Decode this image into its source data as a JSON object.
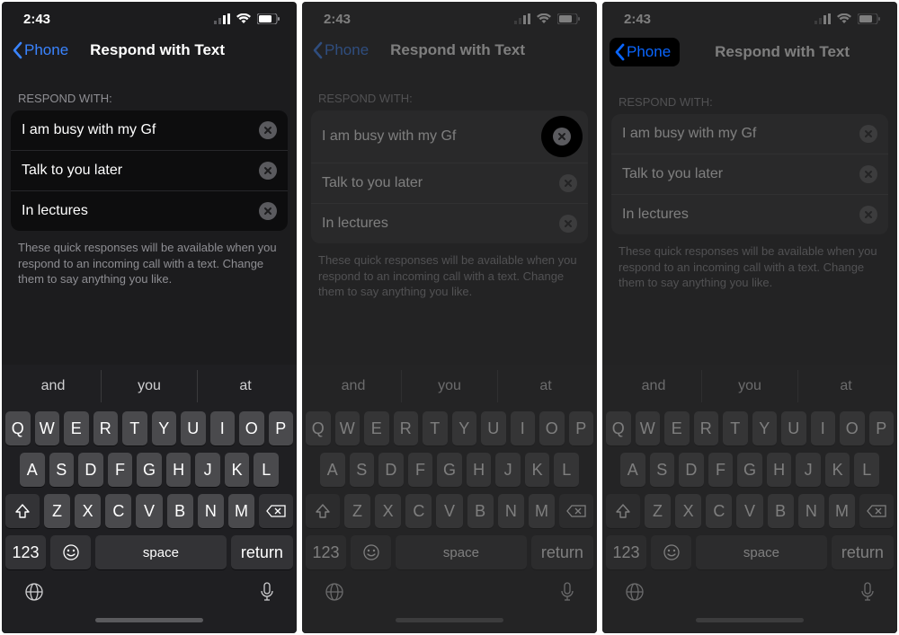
{
  "status": {
    "time": "2:43"
  },
  "nav": {
    "back_label": "Phone",
    "title": "Respond with Text"
  },
  "section_header": "RESPOND WITH:",
  "responses": [
    {
      "text": "I am busy with my Gf"
    },
    {
      "text": "Talk to you later"
    },
    {
      "text": "In lectures"
    }
  ],
  "footer_note": "These quick responses will be available when you respond to an incoming call with a text. Change them to say anything you like.",
  "suggestions": [
    "and",
    "you",
    "at"
  ],
  "kbd_rows": {
    "r1": [
      "Q",
      "W",
      "E",
      "R",
      "T",
      "Y",
      "U",
      "I",
      "O",
      "P"
    ],
    "r2": [
      "A",
      "S",
      "D",
      "F",
      "G",
      "H",
      "J",
      "K",
      "L"
    ],
    "r3": [
      "Z",
      "X",
      "C",
      "V",
      "B",
      "N",
      "M"
    ]
  },
  "kbd_labels": {
    "num": "123",
    "space": "space",
    "return": "return"
  }
}
